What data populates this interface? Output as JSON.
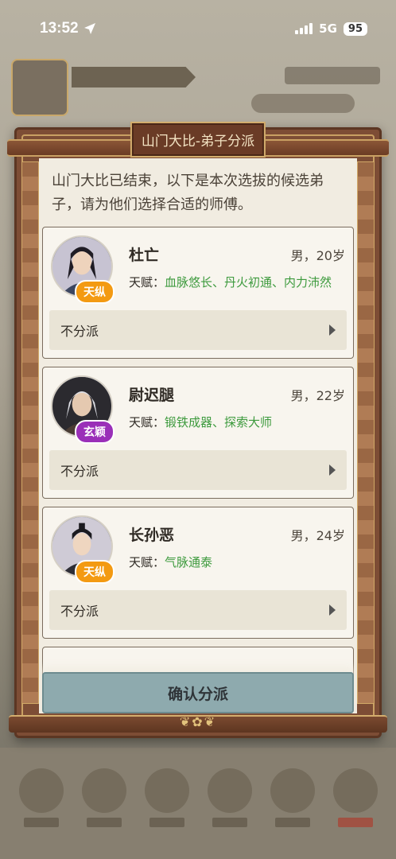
{
  "status_bar": {
    "time": "13:52",
    "network": "5G",
    "battery": "95"
  },
  "dialog": {
    "title": "山门大比-弟子分派",
    "intro": "山门大比已结束，以下是本次选拔的候选弟子，请为他们选择合适的师傅。",
    "talent_label": "天赋：",
    "candidates": [
      {
        "name": "杜亡",
        "gender_age": "男，20岁",
        "rank": "天纵",
        "rank_color": "#f39a12",
        "talent": "血脉悠长、丹火初通、内力沛然",
        "assignment": "不分派"
      },
      {
        "name": "尉迟腿",
        "gender_age": "男，22岁",
        "rank": "玄颖",
        "rank_color": "#9a2fb8",
        "talent": "锻铁成器、探索大师",
        "assignment": "不分派"
      },
      {
        "name": "长孙恶",
        "gender_age": "男，24岁",
        "rank": "天纵",
        "rank_color": "#f39a12",
        "talent": "气脉通泰",
        "assignment": "不分派"
      }
    ],
    "confirm_label": "确认分派"
  },
  "icons": {
    "location_arrow": "location-arrow-icon",
    "assign_chevron": "chevron-right-icon"
  }
}
